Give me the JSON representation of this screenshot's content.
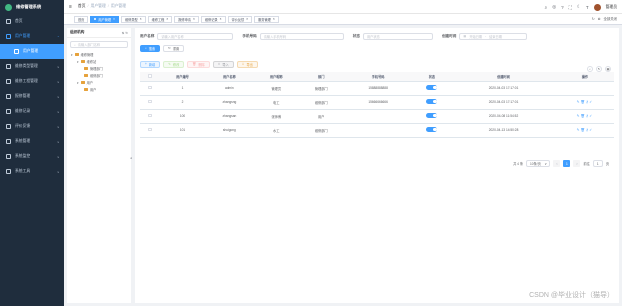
{
  "app": {
    "title": "维修管理系统"
  },
  "sidebar": {
    "items": [
      {
        "label": "首页",
        "icon": "home-icon"
      },
      {
        "label": "用户管理",
        "icon": "user-icon",
        "expanded": true,
        "children": [
          {
            "label": "用户管理",
            "selected": true
          }
        ]
      },
      {
        "label": "维修类型管理",
        "icon": "list-icon"
      },
      {
        "label": "维修工程管理",
        "icon": "wrench-icon"
      },
      {
        "label": "报修管理",
        "icon": "form-icon"
      },
      {
        "label": "维修记录",
        "icon": "record-icon"
      },
      {
        "label": "评价反馈",
        "icon": "comment-icon"
      },
      {
        "label": "系统管理",
        "icon": "gear-icon"
      },
      {
        "label": "系统监控",
        "icon": "monitor-icon"
      },
      {
        "label": "系统工具",
        "icon": "tool-icon"
      }
    ]
  },
  "topbar": {
    "breadcrumb": [
      "首页",
      "用户管理",
      "用户管理"
    ],
    "username": "管理员"
  },
  "tabs": {
    "items": [
      "首页",
      "用户管理",
      "维修类型",
      "维修工程",
      "报修申请",
      "维修记录",
      "评价反馈",
      "服务管理"
    ],
    "active_index": 1,
    "refresh": "刷新",
    "close_all": "全部关闭"
  },
  "tree": {
    "title": "组织机构",
    "search_placeholder": "请输入部门名称",
    "nodes": [
      {
        "label": "维修管理",
        "level": 0
      },
      {
        "label": "维修站",
        "level": 1
      },
      {
        "label": "管理部门",
        "level": 2
      },
      {
        "label": "维修部门",
        "level": 2
      },
      {
        "label": "用户",
        "level": 1
      },
      {
        "label": "用户",
        "level": 2
      }
    ]
  },
  "filters": {
    "username_label": "用户名称",
    "username_placeholder": "请输入用户名称",
    "phone_label": "手机号码",
    "phone_placeholder": "请输入手机号码",
    "status_label": "状态",
    "status_placeholder": "用户状态",
    "created_label": "创建时间",
    "start_placeholder": "开始日期",
    "range_sep": "-",
    "end_placeholder": "结束日期",
    "search_btn": "搜索",
    "reset_btn": "重置"
  },
  "actions": {
    "add": "新增",
    "edit": "修改",
    "delete": "删除",
    "import": "导入",
    "export": "导出"
  },
  "table": {
    "headers": [
      "",
      "用户编号",
      "用户名称",
      "用户昵称",
      "部门",
      "手机号码",
      "状态",
      "创建时间",
      "操作"
    ],
    "rows": [
      {
        "id": "1",
        "name": "admin",
        "nick": "管理员",
        "dept": "管理部门",
        "phone": "15888888888",
        "created": "2020-04-03 17:17:01"
      },
      {
        "id": "2",
        "name": "zhangsng",
        "nick": "电工",
        "dept": "维修部门",
        "phone": "15666666666",
        "created": "2020-04-03 17:17:01"
      },
      {
        "id": "100",
        "name": "zhangsan",
        "nick": "张师傅",
        "dept": "用户",
        "phone": "",
        "created": "2020-04-08 11:54:52"
      },
      {
        "id": "101",
        "name": "shuigong",
        "nick": "水工",
        "dept": "维修部门",
        "phone": "",
        "created": "2020-04-13 14:50:28"
      }
    ]
  },
  "pager": {
    "total": "共 4 条",
    "page_size": "10条/页",
    "current": "1",
    "prev": "<",
    "next": ">",
    "goto": "前往",
    "goto_val": "1",
    "page_suffix": "页"
  },
  "watermark": "CSDN @毕业设计（猫导）"
}
